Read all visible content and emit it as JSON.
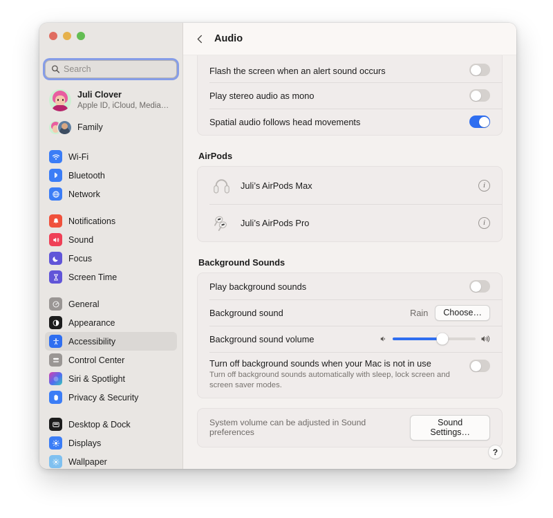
{
  "window": {
    "traffic_lights": [
      "close",
      "minimize",
      "zoom"
    ]
  },
  "sidebar": {
    "search": {
      "placeholder": "Search",
      "value": "",
      "icon": "search-icon"
    },
    "account": {
      "name": "Juli Clover",
      "subtitle": "Apple ID, iCloud, Media…"
    },
    "family": {
      "label": "Family"
    },
    "groups": [
      {
        "items": [
          {
            "label": "Wi-Fi",
            "icon": "wifi-icon",
            "color": "#3b7df6"
          },
          {
            "label": "Bluetooth",
            "icon": "bluetooth-icon",
            "color": "#3b7df6"
          },
          {
            "label": "Network",
            "icon": "network-globe-icon",
            "color": "#3b7df6"
          }
        ]
      },
      {
        "items": [
          {
            "label": "Notifications",
            "icon": "bell-icon",
            "color": "#f0513c"
          },
          {
            "label": "Sound",
            "icon": "speaker-icon",
            "color": "#ef4056"
          },
          {
            "label": "Focus",
            "icon": "moon-icon",
            "color": "#6155d8"
          },
          {
            "label": "Screen Time",
            "icon": "hourglass-icon",
            "color": "#6155d8"
          }
        ]
      },
      {
        "items": [
          {
            "label": "General",
            "icon": "gear-icon",
            "color": "#9a9694"
          },
          {
            "label": "Appearance",
            "icon": "contrast-icon",
            "color": "#1c1c1c"
          },
          {
            "label": "Accessibility",
            "icon": "accessibility-icon",
            "color": "#2f6ef0",
            "selected": true
          },
          {
            "label": "Control Center",
            "icon": "sliders-icon",
            "color": "#9a9694"
          },
          {
            "label": "Siri & Spotlight",
            "icon": "siri-icon",
            "color": "#2b2b38"
          },
          {
            "label": "Privacy & Security",
            "icon": "hand-icon",
            "color": "#3b7df6"
          }
        ]
      },
      {
        "items": [
          {
            "label": "Desktop & Dock",
            "icon": "desktop-icon",
            "color": "#1c1c1c"
          },
          {
            "label": "Displays",
            "icon": "brightness-icon",
            "color": "#3b7df6"
          },
          {
            "label": "Wallpaper",
            "icon": "wallpaper-icon",
            "color": "#7fc0f0"
          }
        ]
      }
    ]
  },
  "header": {
    "back_icon": "chevron-left-icon",
    "title": "Audio"
  },
  "main": {
    "audio_card": [
      {
        "label": "Flash the screen when an alert sound occurs",
        "toggle": "off"
      },
      {
        "label": "Play stereo audio as mono",
        "toggle": "off"
      },
      {
        "label": "Spatial audio follows head movements",
        "toggle": "on"
      }
    ],
    "airpods": {
      "section_title": "AirPods",
      "devices": [
        {
          "name": "Juli’s AirPods Max",
          "icon": "airpods-max-icon",
          "info_icon": "info-icon"
        },
        {
          "name": "Juli’s AirPods Pro",
          "icon": "airpods-pro-icon",
          "info_icon": "info-icon"
        }
      ]
    },
    "background_sounds": {
      "section_title": "Background Sounds",
      "play_row": {
        "label": "Play background sounds",
        "toggle": "off"
      },
      "sound_row": {
        "label": "Background sound",
        "value": "Rain",
        "button": "Choose…"
      },
      "volume_row": {
        "label": "Background sound volume",
        "left_icon": "speaker-low-icon",
        "right_icon": "speaker-high-icon",
        "percent": 60
      },
      "turn_off_row": {
        "label": "Turn off background sounds when your Mac is not in use",
        "description": "Turn off background sounds automatically with sleep, lock screen and screen saver modes.",
        "toggle": "off"
      }
    },
    "footer": {
      "note": "System volume can be adjusted in Sound preferences",
      "button": "Sound Settings…"
    },
    "help_button": "?"
  },
  "colors": {
    "accent": "#2f6ef0",
    "sidebar_bg": "#e9e6e3",
    "content_bg": "#f4f1ef",
    "card_bg": "#f0eceb"
  }
}
